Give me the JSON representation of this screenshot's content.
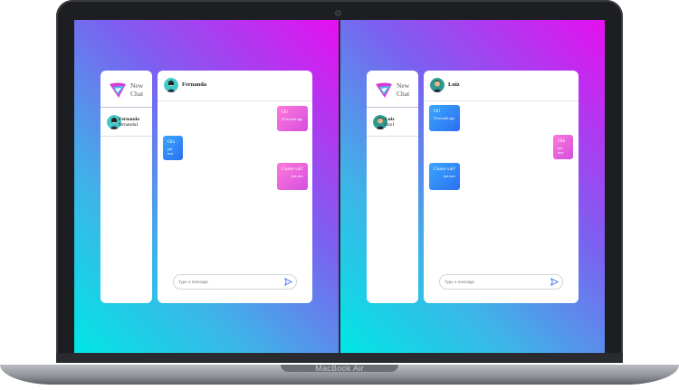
{
  "device": {
    "label": "MacBook Air"
  },
  "panels": [
    {
      "sidebar": {
        "brand": "New Chat",
        "contact": {
          "name": "Fernanda",
          "username": "fernanda1"
        }
      },
      "chat": {
        "contact_name": "Fernanda",
        "messages": [
          {
            "text": "Oi!",
            "time": "10 seconds ago",
            "dir": "out"
          },
          {
            "text": "Olá",
            "time": "just now",
            "dir": "in"
          },
          {
            "text": "Como vai?",
            "time": "just now",
            "dir": "out"
          }
        ],
        "input_placeholder": "Type a message"
      }
    },
    {
      "sidebar": {
        "brand": "New Chat",
        "contact": {
          "name": "Luiz",
          "username": "luiz1"
        }
      },
      "chat": {
        "contact_name": "Luiz",
        "messages": [
          {
            "text": "Oi!",
            "time": "10 seconds ago",
            "dir": "in"
          },
          {
            "text": "Olá",
            "time": "just now",
            "dir": "out"
          },
          {
            "text": "Como vai?",
            "time": "just now",
            "dir": "in"
          }
        ],
        "input_placeholder": "Type a message"
      }
    }
  ],
  "colors": {
    "gradient_start": "#00e6e6",
    "gradient_end": "#e60ff0",
    "out_bubble": "#e455e6",
    "in_bubble": "#2e8af6"
  }
}
